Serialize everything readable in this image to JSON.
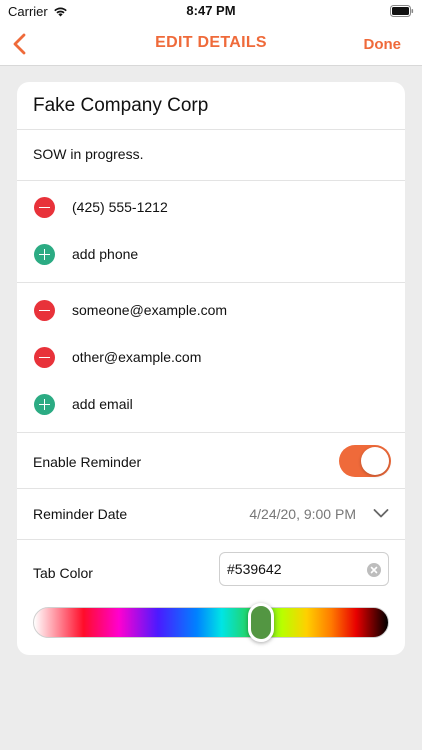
{
  "status_bar": {
    "carrier": "Carrier",
    "time": "8:47 PM"
  },
  "nav": {
    "title": "EDIT DETAILS",
    "done_label": "Done",
    "back_icon": "chevron-left-icon"
  },
  "accent_color": "#ef6a3a",
  "company_name": "Fake Company Corp",
  "notes": "SOW in progress.",
  "phones": [
    {
      "value": "(425) 555-1212",
      "action": "remove"
    }
  ],
  "add_phone_label": "add phone",
  "emails": [
    {
      "value": "someone@example.com",
      "action": "remove"
    },
    {
      "value": "other@example.com",
      "action": "remove"
    }
  ],
  "add_email_label": "add email",
  "reminder": {
    "label": "Enable Reminder",
    "enabled": true
  },
  "reminder_date": {
    "label": "Reminder Date",
    "value": "4/24/20, 9:00 PM"
  },
  "tab_color": {
    "label": "Tab Color",
    "value": "#539642",
    "slider_fraction": 0.64
  },
  "colors": {
    "remove": "#e8323a",
    "add": "#2bab83"
  }
}
